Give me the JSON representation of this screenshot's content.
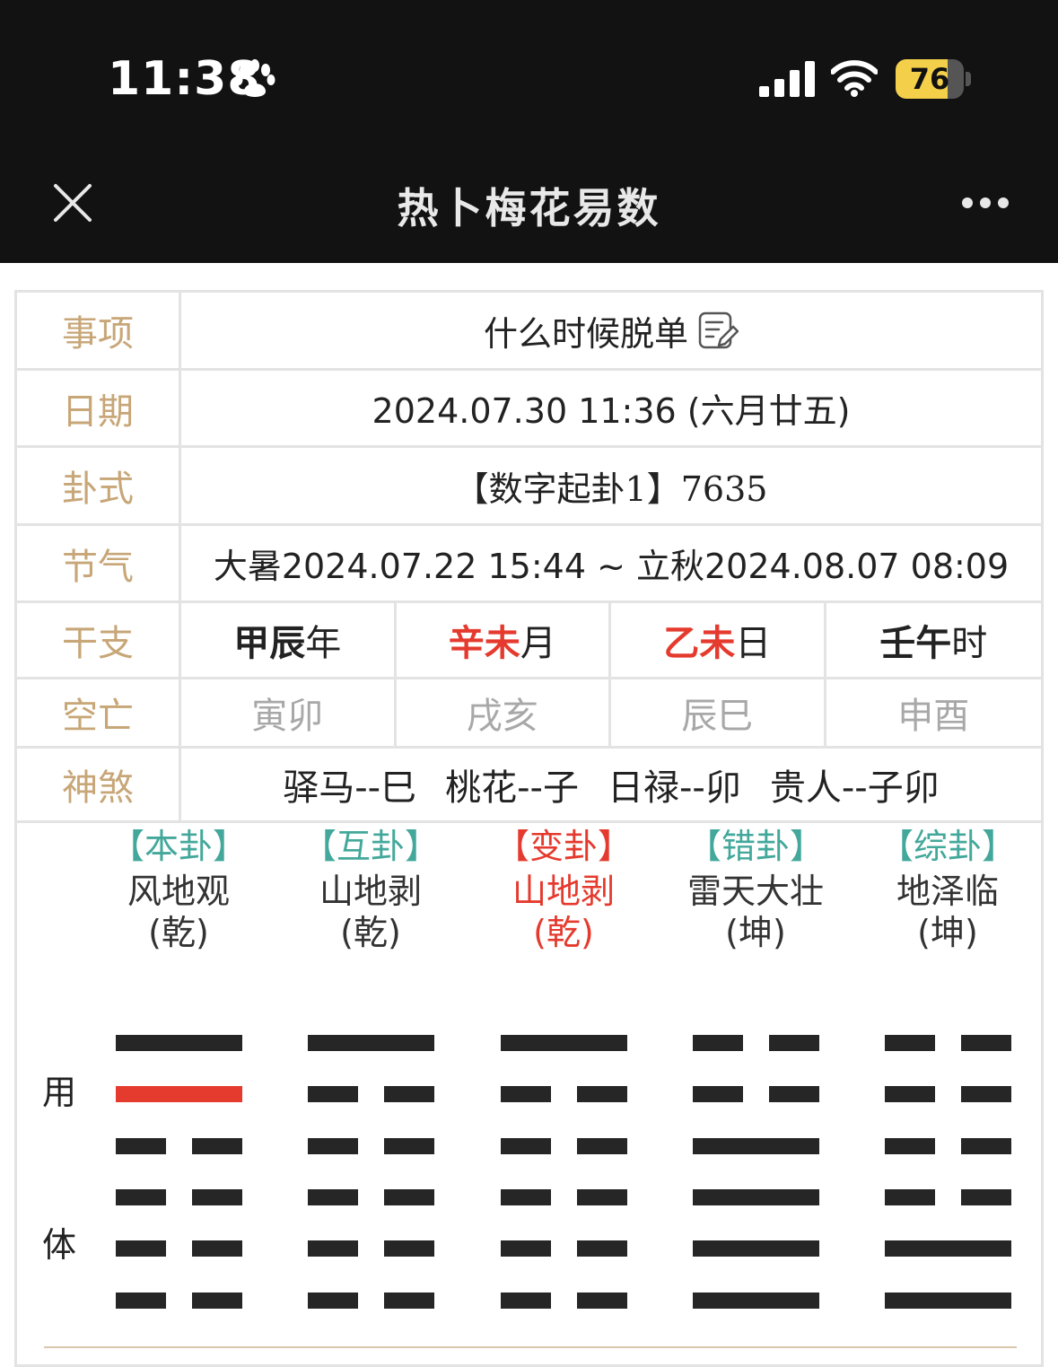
{
  "status": {
    "time": "11:38",
    "battery": "76",
    "battery_fraction": 0.76,
    "icons": [
      "paw-icon",
      "signal-icon",
      "wifi-icon",
      "battery-icon"
    ]
  },
  "nav": {
    "title": "热卜梅花易数",
    "close_icon": "close-icon",
    "more_icon": "more-icon"
  },
  "info": {
    "matter": {
      "label": "事项",
      "value": "什么时候脱单"
    },
    "date": {
      "label": "日期",
      "value": "2024.07.30 11:36 (六月廿五)"
    },
    "method": {
      "label": "卦式",
      "value": "【数字起卦1】7635"
    },
    "solar_term": {
      "label": "节气",
      "value": "大暑2024.07.22 15:44 ~ 立秋2024.08.07 08:09"
    },
    "ganzhi": {
      "label": "干支",
      "cells": [
        {
          "stem": "甲辰",
          "suffix": "年"
        },
        {
          "stem": "辛未",
          "suffix": "月"
        },
        {
          "stem": "乙未",
          "suffix": "日"
        },
        {
          "stem": "壬午",
          "suffix": "时"
        }
      ]
    },
    "kongwang": {
      "label": "空亡",
      "cells": [
        "寅卯",
        "戌亥",
        "辰巳",
        "申酉"
      ]
    },
    "shensha": {
      "label": "神煞",
      "items": [
        "驿马--巳",
        "桃花--子",
        "日禄--卯",
        "贵人--子卯"
      ]
    }
  },
  "colors": {
    "accent_gold": "#c7a677",
    "accent_teal": "#43a89b",
    "accent_red": "#e53a2e",
    "line_dark": "#262626"
  },
  "hexagrams": {
    "side_labels": {
      "yong": "用",
      "ti": "体"
    },
    "items": [
      {
        "tag": "【本卦】",
        "name": "风地观",
        "gong": "(乾)",
        "lines": [
          "yang",
          "yang",
          "yin",
          "yin",
          "yin",
          "yin"
        ],
        "moving": [
          1
        ]
      },
      {
        "tag": "【互卦】",
        "name": "山地剥",
        "gong": "(乾)",
        "lines": [
          "yang",
          "yin",
          "yin",
          "yin",
          "yin",
          "yin"
        ],
        "moving": []
      },
      {
        "tag": "【变卦】",
        "name": "山地剥",
        "gong": "(乾)",
        "lines": [
          "yang",
          "yin",
          "yin",
          "yin",
          "yin",
          "yin"
        ],
        "moving": []
      },
      {
        "tag": "【错卦】",
        "name": "雷天大壮",
        "gong": "(坤)",
        "lines": [
          "yin",
          "yin",
          "yang",
          "yang",
          "yang",
          "yang"
        ],
        "moving": []
      },
      {
        "tag": "【综卦】",
        "name": "地泽临",
        "gong": "(坤)",
        "lines": [
          "yin",
          "yin",
          "yin",
          "yin",
          "yang",
          "yang"
        ],
        "moving": []
      }
    ]
  }
}
